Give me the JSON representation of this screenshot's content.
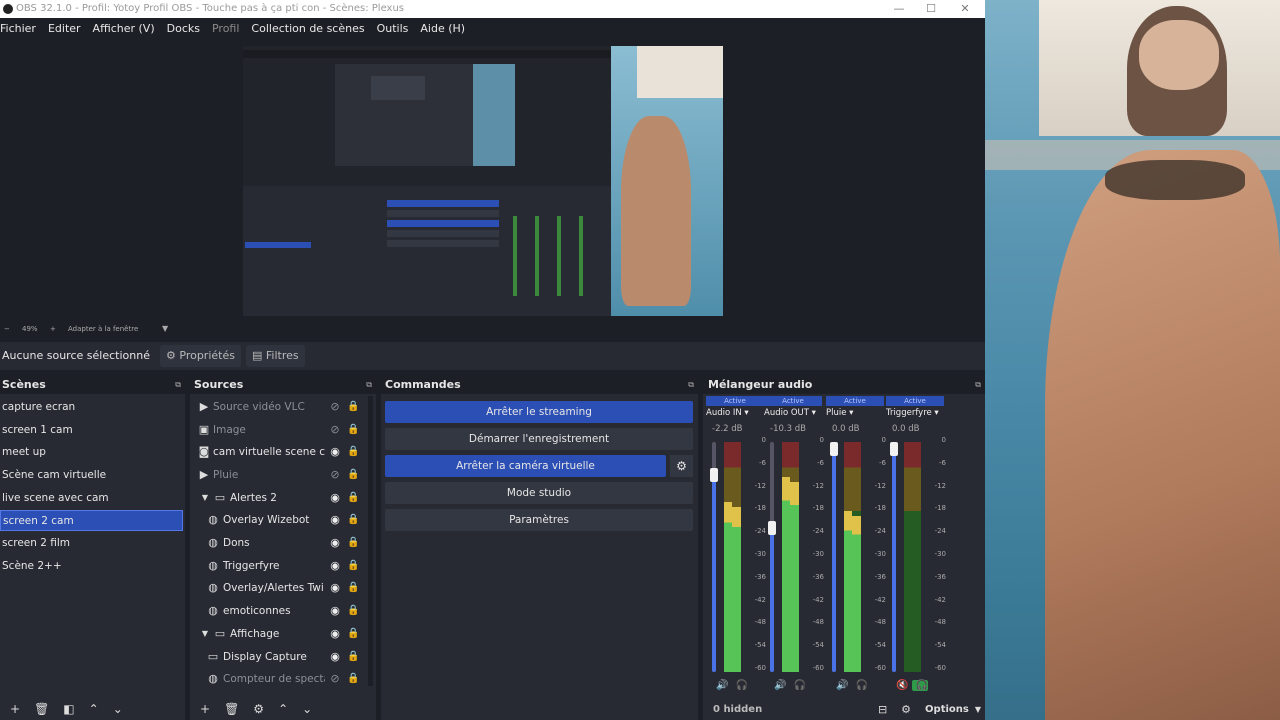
{
  "window": {
    "title": "OBS 32.1.0 - Profil: Yotoy Profil OBS - Touche pas à ça pti con - Scènes: Plexus"
  },
  "menu": {
    "items": [
      "Fichier",
      "Editer",
      "Afficher (V)",
      "Docks",
      "Profil",
      "Collection de scènes",
      "Outils",
      "Aide (H)"
    ]
  },
  "zoom": {
    "minus": "−",
    "value": "49%",
    "plus": "+",
    "fit_label": "Adapter à la fenêtre"
  },
  "context": {
    "no_source": "Aucune source sélectionné",
    "properties": "Propriétés",
    "filters": "Filtres"
  },
  "scenes": {
    "title": "Scènes",
    "items": [
      "capture ecran",
      "screen 1 cam",
      "meet up",
      "Scène cam virtuelle",
      "live scene avec cam",
      "screen 2 cam",
      "screen 2 film",
      "Scène 2++"
    ],
    "selected_index": 5
  },
  "sources": {
    "title": "Sources",
    "items": [
      {
        "label": "Source vidéo VLC",
        "icon": "play-icon",
        "visible": false
      },
      {
        "label": "Image",
        "icon": "image-icon",
        "visible": false
      },
      {
        "label": "cam virtuelle scene cam",
        "icon": "camera-icon",
        "visible": true
      },
      {
        "label": "Pluie",
        "icon": "play-icon",
        "visible": false
      },
      {
        "label": "Alertes 2",
        "icon": "folder-icon",
        "visible": true
      },
      {
        "label": "Overlay Wizebot",
        "icon": "globe-icon",
        "visible": true
      },
      {
        "label": "Dons",
        "icon": "globe-icon",
        "visible": true
      },
      {
        "label": "Triggerfyre",
        "icon": "globe-icon",
        "visible": true
      },
      {
        "label": "Overlay/Alertes Twitch",
        "icon": "globe-icon",
        "visible": true
      },
      {
        "label": "emoticonnes",
        "icon": "globe-icon",
        "visible": true
      },
      {
        "label": "Affichage",
        "icon": "folder-icon",
        "visible": true
      },
      {
        "label": "Display Capture",
        "icon": "monitor-icon",
        "visible": true
      },
      {
        "label": "Compteur de spectateurs",
        "icon": "globe-icon",
        "visible": false
      }
    ]
  },
  "commands": {
    "title": "Commandes",
    "stop_streaming": "Arrêter le streaming",
    "start_recording": "Démarrer l'enregistrement",
    "stop_virtual_cam": "Arrêter la caméra virtuelle",
    "studio_mode": "Mode studio",
    "settings": "Paramètres"
  },
  "mixer": {
    "title": "Mélangeur audio",
    "hidden_label": "0 hidden",
    "options_label": "Options",
    "scale": [
      "0",
      "-6",
      "-12",
      "-18",
      "-24",
      "-30",
      "-36",
      "-42",
      "-48",
      "-54",
      "-60"
    ],
    "channels": [
      {
        "status": "Active",
        "name": "Audio IN",
        "db": "-2.2 dB",
        "volume": 0.87,
        "level": 0.74
      },
      {
        "status": "Active",
        "name": "Audio OUT",
        "db": "-10.3 dB",
        "volume": 0.64,
        "level": 0.85
      },
      {
        "status": "Active",
        "name": "Pluie",
        "db": "0.0 dB",
        "volume": 1.0,
        "level": 0.7
      },
      {
        "status": "Active",
        "name": "Triggerfyre",
        "db": "0.0 dB",
        "volume": 1.0,
        "level": 0.0
      }
    ]
  },
  "colors": {
    "accent": "#2c4fb5",
    "panel": "#272a33",
    "background": "#1d1f26"
  }
}
